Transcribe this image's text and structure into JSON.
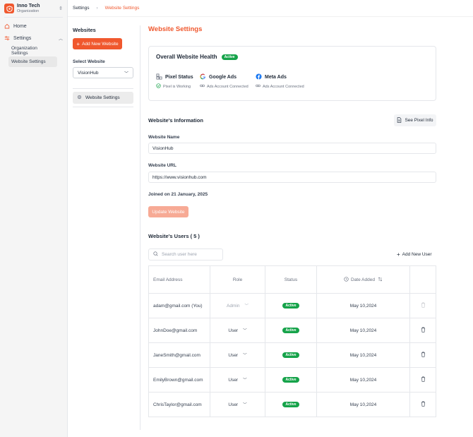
{
  "org": {
    "name": "Inno Tech",
    "subtitle": "Organization"
  },
  "sidebar": {
    "home": "Home",
    "settings": "Settings",
    "sub": [
      "Organization Settings",
      "Website Settings"
    ]
  },
  "breadcrumb": {
    "root": "Settings",
    "current": "Website Settings"
  },
  "panel": {
    "title": "Websites",
    "add_button": "Add New Website",
    "select_label": "Select Website",
    "selected": "VisionHub",
    "nav_item": "Website Settings"
  },
  "main": {
    "title": "Website Settings",
    "health": {
      "title": "Overall Website Health",
      "badge": "Active",
      "items": [
        {
          "name": "Pixel Status",
          "status": "Pixel is Working"
        },
        {
          "name": "Google Ads",
          "status": "Ads Account Connected"
        },
        {
          "name": "Meta Ads",
          "status": "Ads Account Connected"
        }
      ]
    },
    "info": {
      "title": "Website's Information",
      "pixel_button": "See Pixel Info",
      "name_label": "Website Name",
      "name_value": "VisionHub",
      "url_label": "Website URL",
      "url_value": "https://www.visionhub.com",
      "joined": "Joined on 21 January, 2025",
      "update_button": "Update Website"
    },
    "users": {
      "title": "Website's Users ( 5 )",
      "search_placeholder": "Search user here",
      "add_button": "Add New User",
      "columns": [
        "Email Address",
        "Role",
        "Status",
        "Date Added"
      ],
      "rows": [
        {
          "email": "adam@gmail.com (You)",
          "role": "Admin",
          "status": "Active",
          "date": "May 10,2024"
        },
        {
          "email": "JohnDoe@gmail.com",
          "role": "User",
          "status": "Active",
          "date": "May 10,2024"
        },
        {
          "email": "JaneSmith@gmail.com",
          "role": "User",
          "status": "Active",
          "date": "May 10,2024"
        },
        {
          "email": "EmilyBrown@gmail.com",
          "role": "User",
          "status": "Active",
          "date": "May 10,2024"
        },
        {
          "email": "ChrisTaylor@gmail.com",
          "role": "User",
          "status": "Active",
          "date": "May 10,2024"
        }
      ]
    }
  },
  "colors": {
    "accent": "#f0582e",
    "success": "#16a34a"
  }
}
